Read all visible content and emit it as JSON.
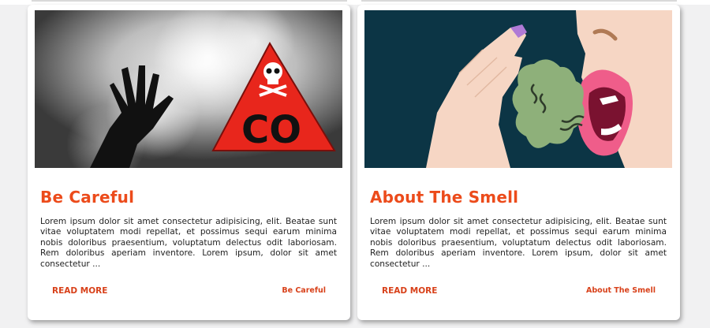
{
  "cards": [
    {
      "title": "Be Careful",
      "body": "Lorem ipsum dolor sit amet consectetur adipisicing, elit. Beatae sunt vitae voluptatem modi repellat, et possimus sequi earum minima nobis doloribus praesentium, voluptatum delectus odit laboriosam. Rem doloribus aperiam inventore. Lorem ipsum, dolor sit amet consectetur ...",
      "read_more": "READ MORE",
      "tag": "Be Careful",
      "image_text": "CO"
    },
    {
      "title": "About The Smell",
      "body": "Lorem ipsum dolor sit amet consectetur adipisicing, elit. Beatae sunt vitae voluptatem modi repellat, et possimus sequi earum minima nobis doloribus praesentium, voluptatum delectus odit laboriosam. Rem doloribus aperiam inventore. Lorem ipsum, dolor sit amet consectetur ...",
      "read_more": "READ MORE",
      "tag": "About The Smell"
    }
  ],
  "colors": {
    "accent": "#ec4b1b",
    "link": "#d8411a",
    "warning_red": "#e8261c",
    "smell_bg": "#0c3545",
    "smell_green": "#8eb07a",
    "lips_pink": "#ef5d8a",
    "skin": "#f6d6c4"
  }
}
